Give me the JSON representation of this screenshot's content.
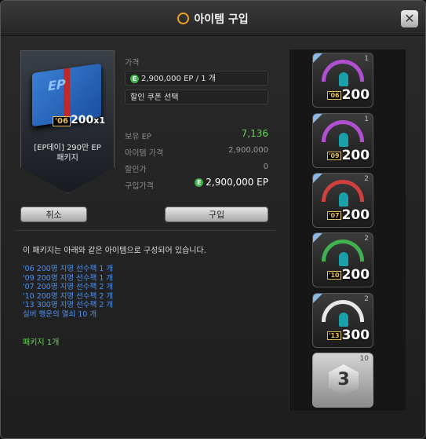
{
  "window": {
    "title": "아이템 구입",
    "close_label": "✕"
  },
  "card": {
    "box_text": "EP",
    "year": "'06",
    "badge_value": "200",
    "badge_mult": "x1",
    "name_line1": "[EP데이] 290만 EP",
    "name_line2": "패키지"
  },
  "price": {
    "label": "가격",
    "coin": "E",
    "amount": "2,900,000",
    "unit": "EP",
    "sep": "/",
    "per": "1 개",
    "coupon_placeholder": "할인 쿠폰 선택"
  },
  "summary": {
    "owned_label": "보유 EP",
    "owned_value": "7,136",
    "item_price_label": "아이템 가격",
    "item_price_value": "2,900,000",
    "discount_label": "할인가",
    "discount_value": "0",
    "purchase_label": "구입가격",
    "purchase_value": "2,900,000 EP"
  },
  "buttons": {
    "cancel": "취소",
    "buy": "구입"
  },
  "description": "이 패키지는 아래와 같은 아이템으로 구성되어 있습니다.",
  "contents": [
    "'06 200명 지명 선수팩 1 개",
    "'09 200명 지명 선수팩 1 개",
    "'07 200명 지명 선수팩 2 개",
    "'10 200명 지명 선수팩 2 개",
    "'13 300명 지명 선수팩 2 개",
    "실버 행운의 열쇠 10 개"
  ],
  "package_count": "패키지 1개",
  "slots": [
    {
      "year": "'06",
      "value": "200",
      "count": "1",
      "color": "#b050d0"
    },
    {
      "year": "'09",
      "value": "200",
      "count": "1",
      "color": "#b050d0"
    },
    {
      "year": "'07",
      "value": "200",
      "count": "2",
      "color": "#d04040"
    },
    {
      "year": "'10",
      "value": "200",
      "count": "2",
      "color": "#40b050"
    },
    {
      "year": "'13",
      "value": "300",
      "count": "2",
      "color": "#e8e8e8"
    },
    {
      "hex": "3",
      "count": "10"
    }
  ]
}
